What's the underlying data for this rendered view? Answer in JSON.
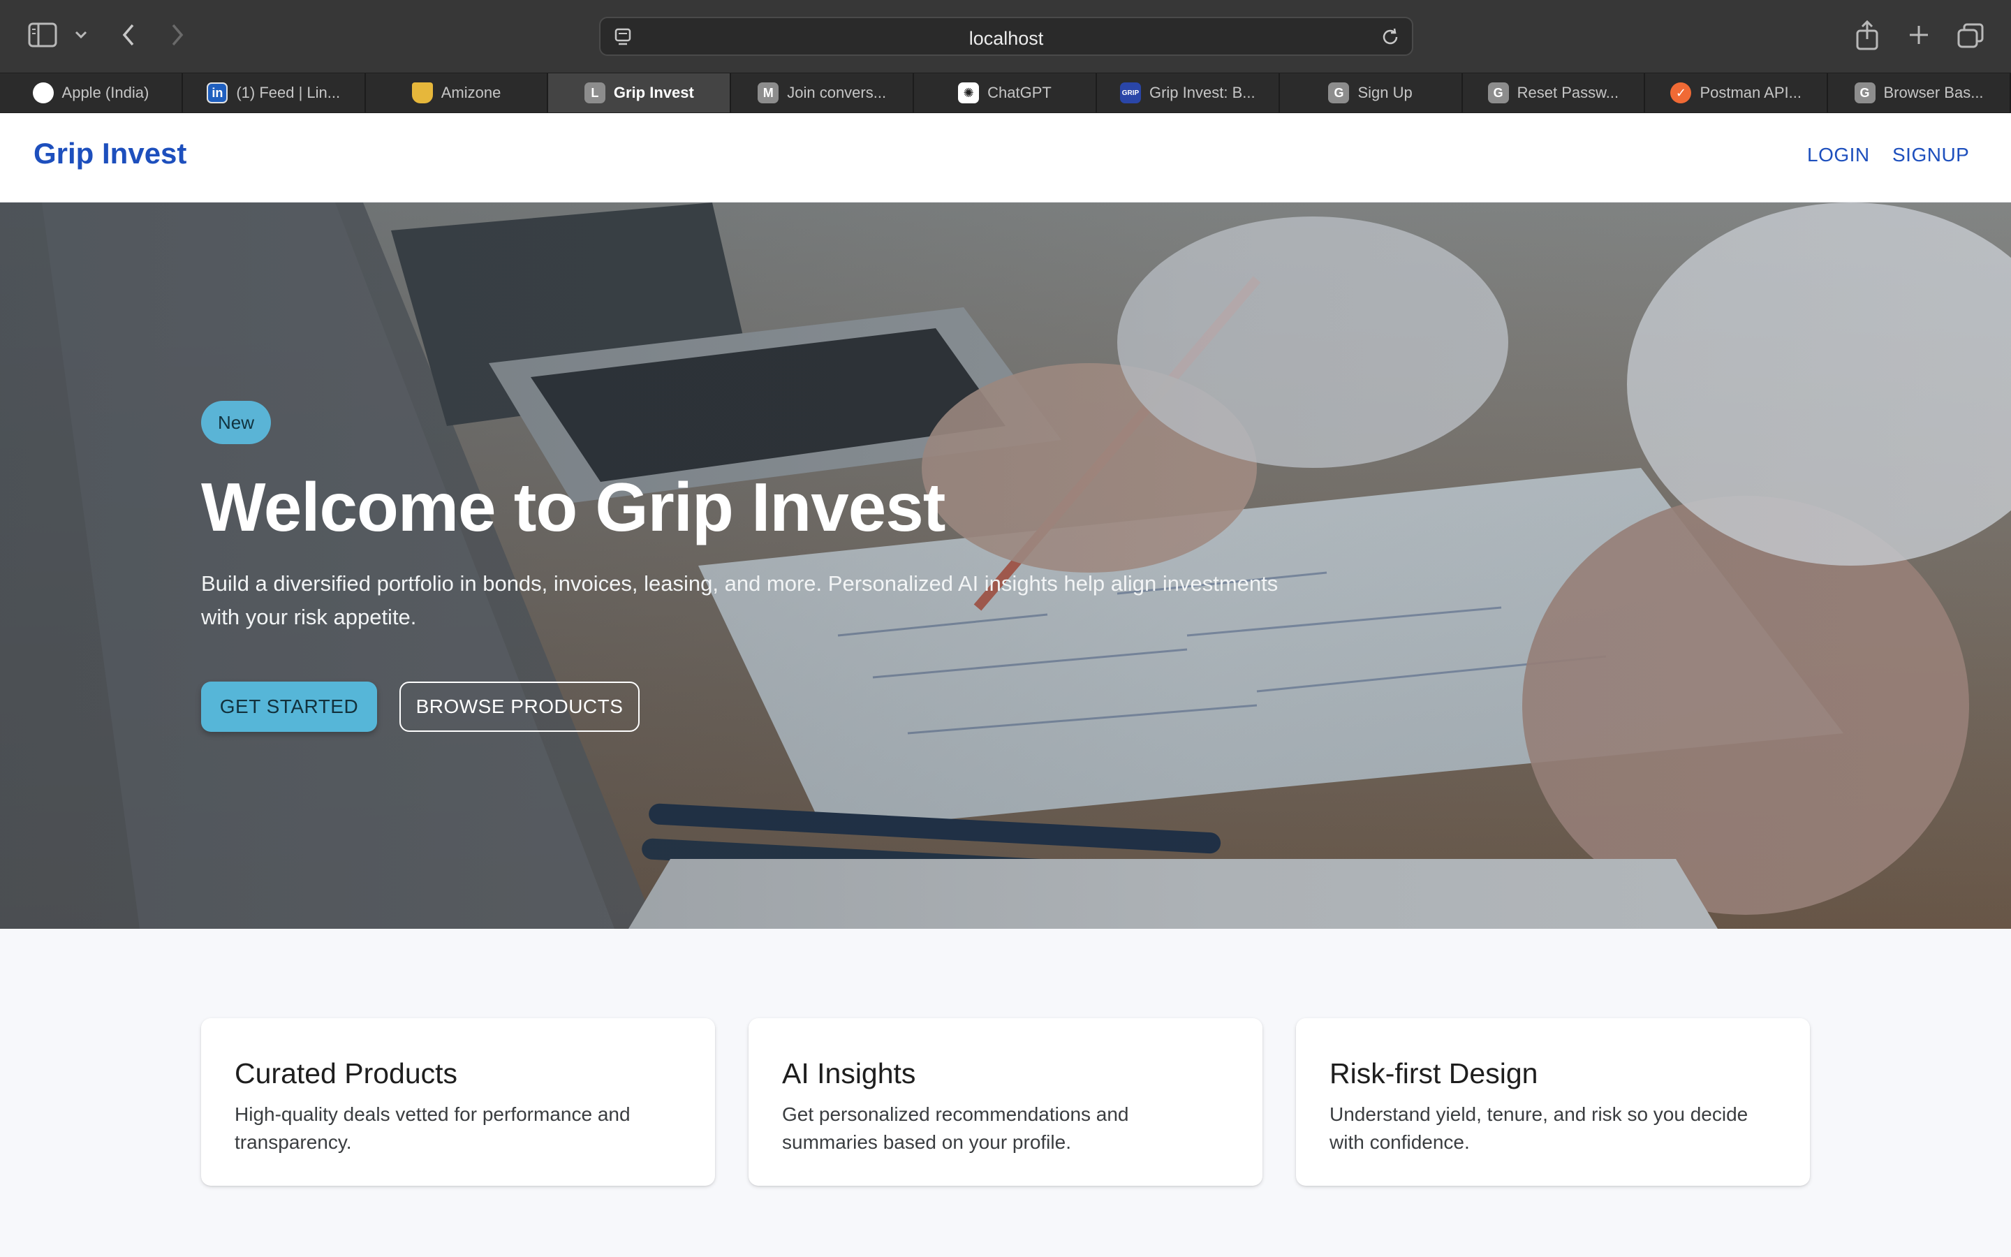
{
  "browser": {
    "url": "localhost",
    "tabs": [
      {
        "label": "Apple (India)",
        "icon": "apple-icon",
        "active": false
      },
      {
        "label": "(1) Feed | Lin...",
        "icon": "linkedin-icon",
        "active": false
      },
      {
        "label": "Amizone",
        "icon": "amizone-icon",
        "active": false
      },
      {
        "label": "Grip Invest",
        "icon": "letter-l-icon",
        "active": true,
        "fav": "L"
      },
      {
        "label": "Join convers...",
        "icon": "letter-m-icon",
        "active": false,
        "fav": "M"
      },
      {
        "label": "ChatGPT",
        "icon": "chatgpt-icon",
        "active": false
      },
      {
        "label": "Grip Invest: B...",
        "icon": "grip-icon",
        "active": false,
        "fav": "GRIP"
      },
      {
        "label": "Sign Up",
        "icon": "letter-g-icon",
        "active": false,
        "fav": "G"
      },
      {
        "label": "Reset Passw...",
        "icon": "letter-g-icon",
        "active": false,
        "fav": "G"
      },
      {
        "label": "Postman API...",
        "icon": "postman-icon",
        "active": false
      },
      {
        "label": "Browser Bas...",
        "icon": "letter-g-icon",
        "active": false,
        "fav": "G"
      }
    ]
  },
  "nav": {
    "brand": "Grip Invest",
    "login": "LOGIN",
    "signup": "SIGNUP"
  },
  "hero": {
    "badge": "New",
    "title": "Welcome to Grip Invest",
    "subtitle": "Build a diversified portfolio in bonds, invoices, leasing, and more. Personalized AI insights help align investments with your risk appetite.",
    "cta_primary": "GET STARTED",
    "cta_secondary": "BROWSE PRODUCTS"
  },
  "features": [
    {
      "title": "Curated Products",
      "text": "High-quality deals vetted for performance and transparency."
    },
    {
      "title": "AI Insights",
      "text": "Get personalized recommendations and summaries based on your profile."
    },
    {
      "title": "Risk-first Design",
      "text": "Understand yield, tenure, and risk so you decide with confidence."
    }
  ],
  "colors": {
    "brand": "#1d4fbd",
    "accent": "#56b6d8",
    "toolbar": "#373737"
  }
}
